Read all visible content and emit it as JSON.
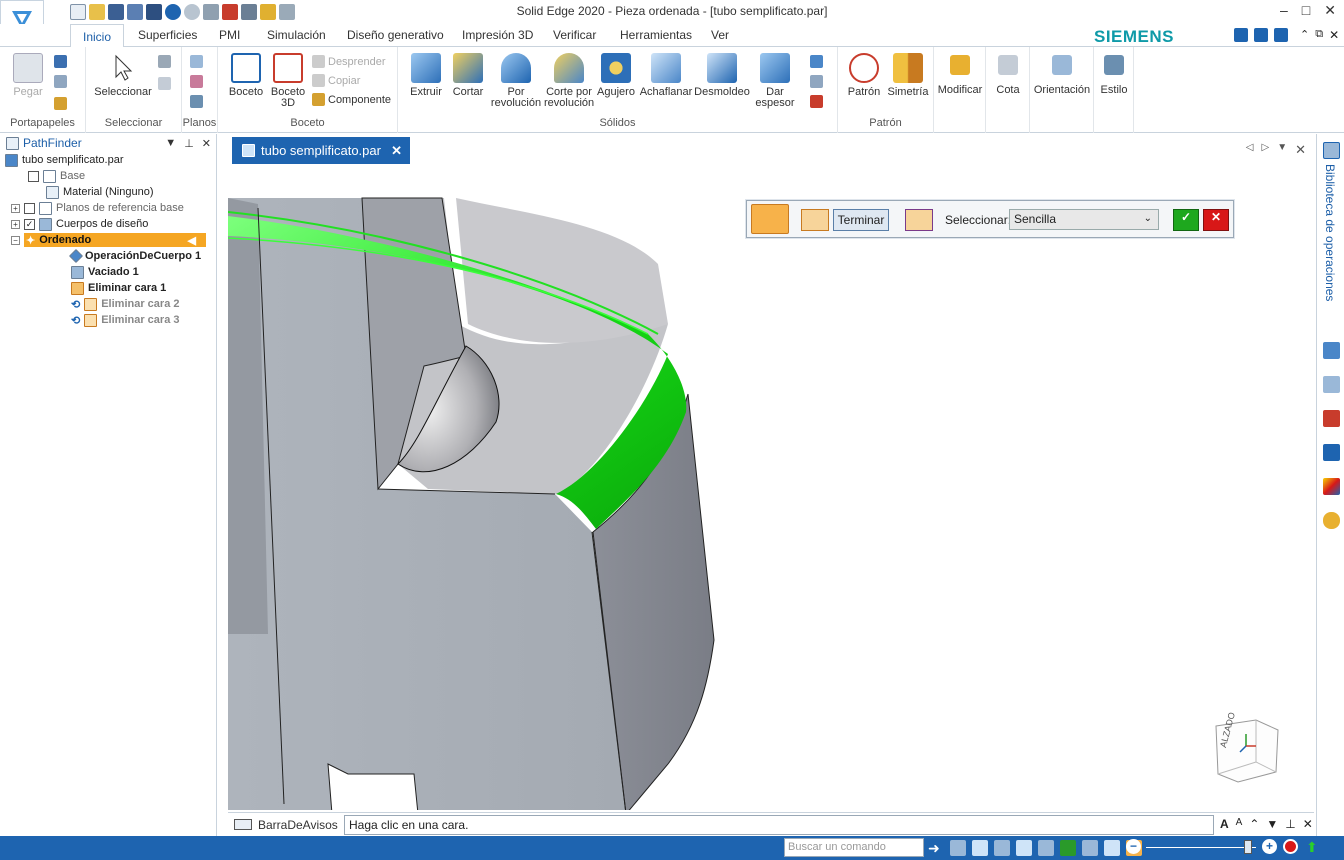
{
  "window": {
    "title": "Solid Edge 2020 - Pieza ordenada - [tubo semplificato.par]",
    "brand": "SIEMENS",
    "brand_color": "#0f9aa8",
    "accent_color": "#1e64b0"
  },
  "tabs": [
    "Inicio",
    "Superficies",
    "PMI",
    "Simulación",
    "Diseño generativo",
    "Impresión 3D",
    "Verificar",
    "Herramientas",
    "Ver"
  ],
  "ribbon": {
    "portapapeles": {
      "label": "Portapapeles",
      "pegar": "Pegar"
    },
    "seleccionar": {
      "label": "Seleccionar",
      "seleccionar": "Seleccionar"
    },
    "planos": {
      "label": "Planos"
    },
    "boceto": {
      "label": "Boceto",
      "boceto": "Boceto",
      "boceto3d": "Boceto 3D",
      "desprender": "Desprender",
      "copiar": "Copiar",
      "componente": "Componente"
    },
    "solidos": {
      "label": "Sólidos",
      "extruir": "Extruir",
      "cortar": "Cortar",
      "por_revolucion": "Por revolución",
      "corte_por_revolucion": "Corte por revolución",
      "agujero": "Agujero",
      "achaflanar": "Achaflanar",
      "desmoldeo": "Desmoldeo",
      "dar_espesor": "Dar espesor"
    },
    "patron": {
      "label": "Patrón",
      "patron": "Patrón",
      "simetria": "Simetría"
    },
    "modificar": "Modificar",
    "cota": "Cota",
    "orientacion": "Orientación",
    "estilo": "Estilo"
  },
  "pathfinder": {
    "title": "PathFinder",
    "file": "tubo semplificato.par",
    "items": [
      {
        "label": "Base"
      },
      {
        "label": "Material (Ninguno)"
      },
      {
        "label": "Planos de referencia base"
      },
      {
        "label": "Cuerpos de diseño"
      },
      {
        "label": "Ordenado"
      },
      {
        "label": "OperaciónDeCuerpo 1"
      },
      {
        "label": "Vaciado 1"
      },
      {
        "label": "Eliminar cara 1"
      },
      {
        "label": "Eliminar cara 2"
      },
      {
        "label": "Eliminar cara 3"
      }
    ]
  },
  "document": {
    "tab": "tubo semplificato.par"
  },
  "command_bar": {
    "terminar": "Terminar",
    "seleccionar_label": "Seleccionar:",
    "seleccionar_value": "Sencilla"
  },
  "view_cube": {
    "face": "ALZADO"
  },
  "right_dock": {
    "library": "Biblioteca de operaciones"
  },
  "prompt": {
    "label": "BarraDeAvisos",
    "text": "Haga clic en una cara."
  },
  "status": {
    "search_placeholder": "Buscar un comando"
  }
}
